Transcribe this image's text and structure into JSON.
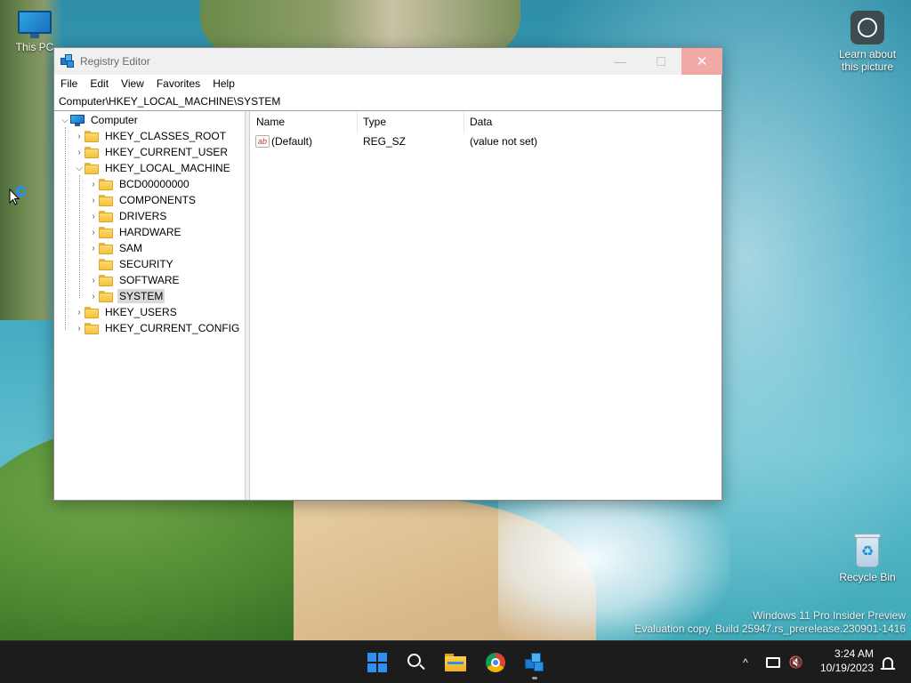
{
  "desktop": {
    "icons": {
      "this_pc": "This PC",
      "recycle_bin": "Recycle Bin",
      "learn_about": "Learn about this picture"
    },
    "watermark": {
      "line1": "Windows 11 Pro Insider Preview",
      "line2": "Evaluation copy. Build 25947.rs_prerelease.230901-1416"
    }
  },
  "window": {
    "title": "Registry Editor",
    "controls": {
      "minimize": "—",
      "close": "✕"
    },
    "menu": [
      "File",
      "Edit",
      "View",
      "Favorites",
      "Help"
    ],
    "address": "Computer\\HKEY_LOCAL_MACHINE\\SYSTEM",
    "tree": {
      "root": "Computer",
      "hives": {
        "classes_root": "HKEY_CLASSES_ROOT",
        "current_user": "HKEY_CURRENT_USER",
        "local_machine": "HKEY_LOCAL_MACHINE",
        "users": "HKEY_USERS",
        "current_config": "HKEY_CURRENT_CONFIG"
      },
      "local_machine_children": [
        "BCD00000000",
        "COMPONENTS",
        "DRIVERS",
        "HARDWARE",
        "SAM",
        "SECURITY",
        "SOFTWARE",
        "SYSTEM"
      ],
      "selected": "SYSTEM"
    },
    "list": {
      "columns": [
        "Name",
        "Type",
        "Data"
      ],
      "rows": [
        {
          "name": "(Default)",
          "type": "REG_SZ",
          "data": "(value not set)",
          "icon": "string-value-icon"
        }
      ]
    }
  },
  "taskbar": {
    "apps": [
      "start-icon",
      "search-icon",
      "file-explorer-icon",
      "chrome-icon",
      "registry-editor-icon"
    ],
    "tray": {
      "chevron": "^",
      "volume": "🔇"
    },
    "clock": {
      "time": "3:24 AM",
      "date": "10/19/2023"
    }
  },
  "colors": {
    "taskbar_bg": "#1c1c1c",
    "close_hover": "#f1a9a6",
    "selection_bg": "#d9d9d9",
    "start_blue": "#2d8ff0"
  }
}
